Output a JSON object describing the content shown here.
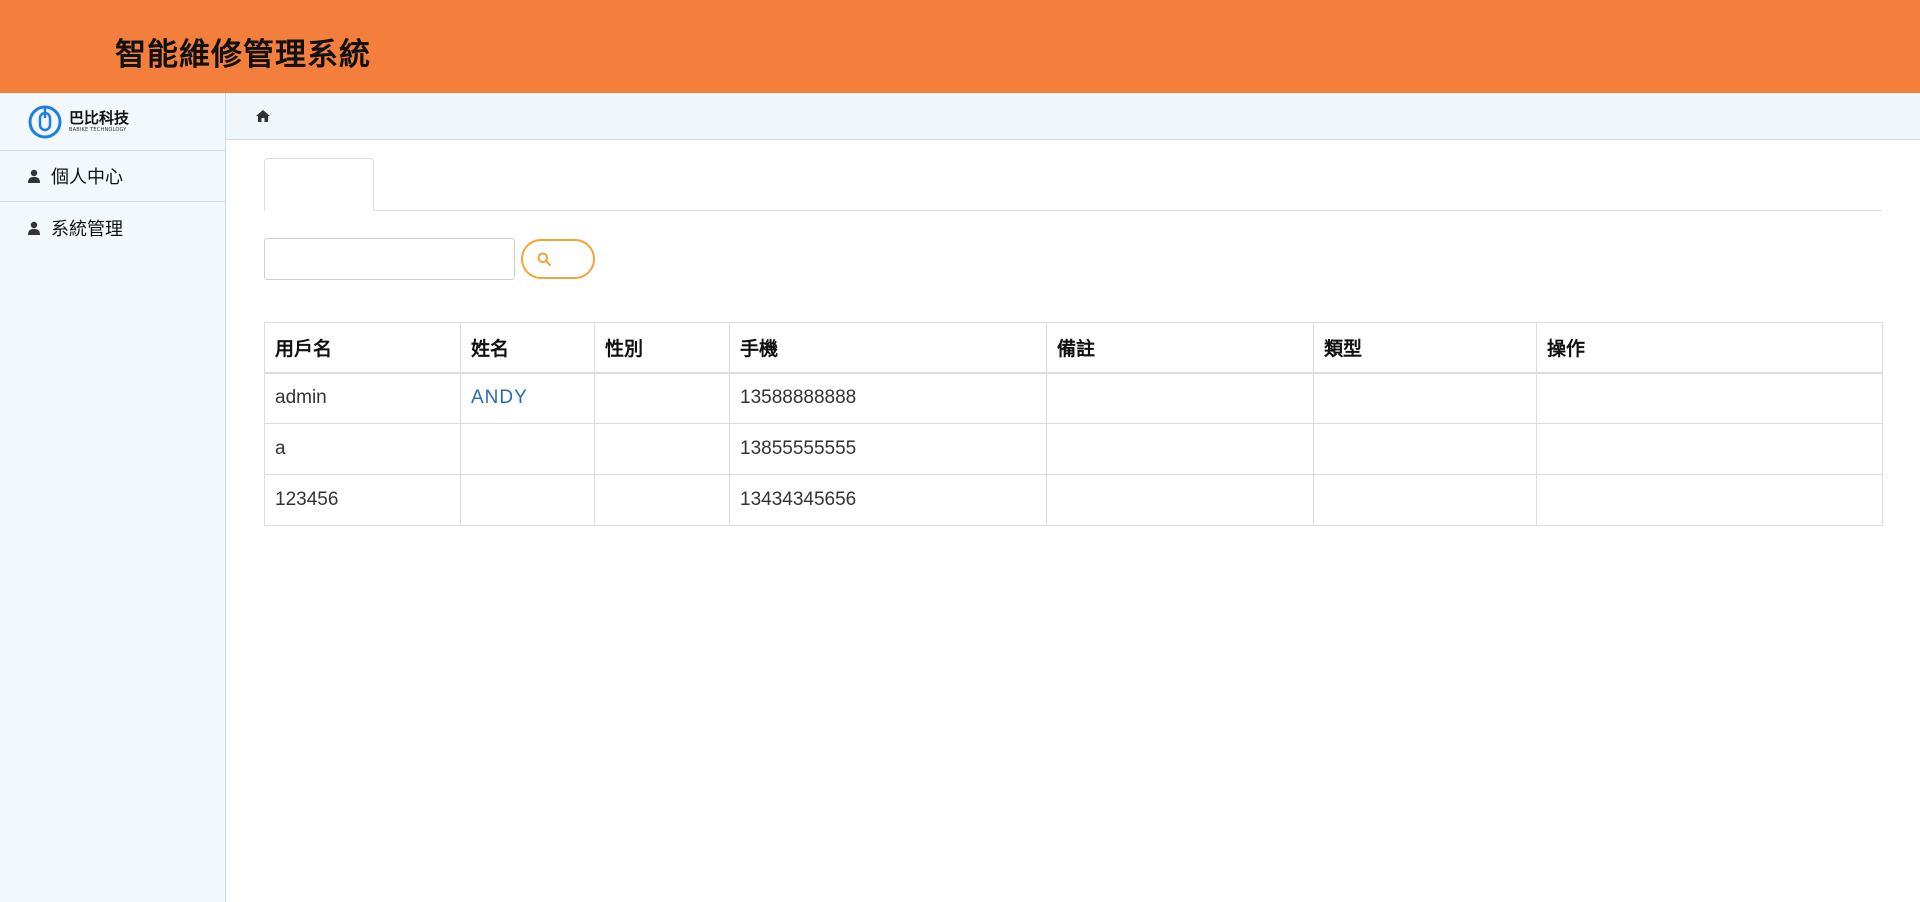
{
  "header": {
    "title": "智能維修管理系統"
  },
  "brand": {
    "name": "巴比科技",
    "subtitle": "BABIKE TECHNOLOGY"
  },
  "sidebar": {
    "items": [
      {
        "label": "個人中心",
        "icon": "user-icon"
      },
      {
        "label": "系統管理",
        "icon": "user-icon"
      }
    ]
  },
  "breadcrumb": {
    "icon": "home-icon"
  },
  "tabs": [
    {
      "label": ""
    }
  ],
  "search": {
    "placeholder": "",
    "button_icon": "search-icon"
  },
  "table": {
    "columns": [
      "用戶名",
      "姓名",
      "性別",
      "手機",
      "備註",
      "類型",
      "操作"
    ],
    "rows": [
      {
        "username": "admin",
        "name": "ANDY",
        "gender": "",
        "phone": "13588888888",
        "remark": "",
        "type": "",
        "action": ""
      },
      {
        "username": "a",
        "name": "",
        "gender": "",
        "phone": "13855555555",
        "remark": "",
        "type": "",
        "action": ""
      },
      {
        "username": "123456",
        "name": "",
        "gender": "",
        "phone": "13434345656",
        "remark": "",
        "type": "",
        "action": ""
      }
    ]
  },
  "colors": {
    "header_bg": "#f47f3d",
    "sidebar_bg": "#f2f8fb",
    "accent_border": "#f0a43a",
    "link_blue": "#2a6ab0"
  }
}
